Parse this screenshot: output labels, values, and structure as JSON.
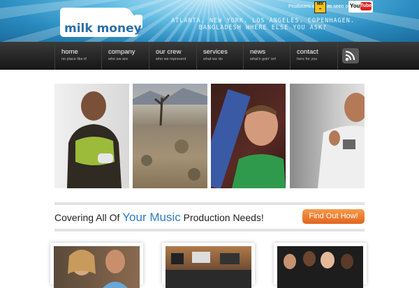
{
  "header": {
    "logo_text": "milk money",
    "tagline": "Atlanta. New York. Los Angeles. Copenhagen. Bangladesh where else you ask?",
    "producers_of": "Producers of",
    "as_seen_on": "as seen on",
    "youtube_you": "You",
    "youtube_tube": "Tube"
  },
  "nav": {
    "items": [
      {
        "label": "home",
        "sub": "no place like it!"
      },
      {
        "label": "company",
        "sub": "who we are"
      },
      {
        "label": "our crew",
        "sub": "who we represent"
      },
      {
        "label": "services",
        "sub": "what we do"
      },
      {
        "label": "news",
        "sub": "what's goin' on!"
      },
      {
        "label": "contact",
        "sub": "here for you"
      }
    ],
    "rss_icon": "rss-icon"
  },
  "main": {
    "headline_before": "Covering All Of ",
    "headline_highlight": "Your Music",
    "headline_after": " Production Needs!",
    "cta_label": "Find Out How!"
  },
  "colors": {
    "accent_blue": "#2f7dc1",
    "cta_orange": "#ef7f2f",
    "nav_dark": "#1f1f1f",
    "header_blue": "#2a8cc0"
  }
}
